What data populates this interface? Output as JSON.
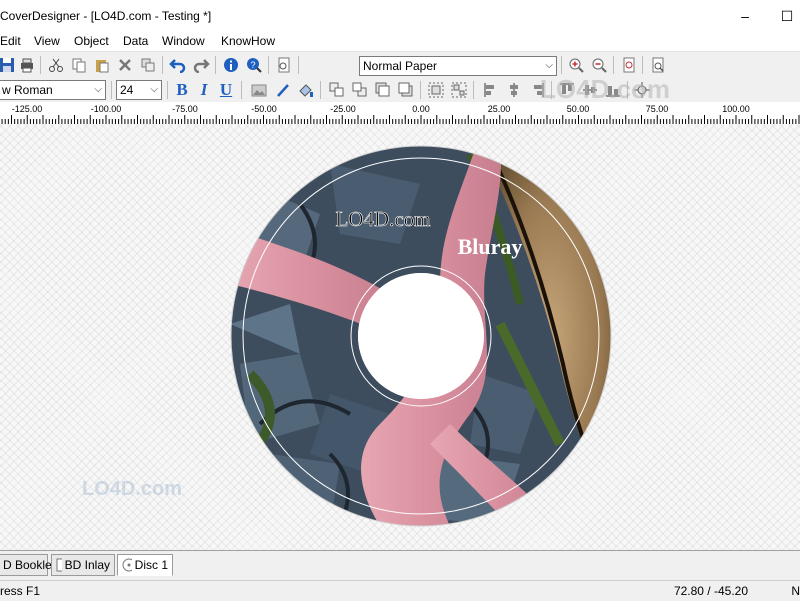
{
  "window": {
    "title": "CoverDesigner - [LO4D.com - Testing *]",
    "minimize": "–",
    "maximize": "☐"
  },
  "menu": [
    "Edit",
    "View",
    "Object",
    "Data",
    "Window",
    "KnowHow"
  ],
  "toolbar": {
    "paper_select": "Normal Paper",
    "font_select": "w Roman",
    "size_select": "24",
    "bold": "B",
    "italic": "I",
    "underline": "U"
  },
  "ruler": {
    "labels": [
      "-125.00",
      "-100.00",
      "-75.00",
      "-50.00",
      "-25.00",
      "0.00",
      "25.00",
      "50.00",
      "75.00",
      "100.00"
    ]
  },
  "disc": {
    "watermark_text": "LO4D.com",
    "label_text": "Bluray"
  },
  "watermarks": {
    "corner": "LO4D.com",
    "canvas": "LO4D.com"
  },
  "tabs": [
    "D Booklet",
    "BD Inlay",
    "Disc 1"
  ],
  "status": {
    "left": "ress F1",
    "coords": "72.80 / -45.20",
    "right": "N"
  },
  "colors": {
    "accent_blue": "#1f5fbf",
    "disc_pink": "#d9909f"
  }
}
